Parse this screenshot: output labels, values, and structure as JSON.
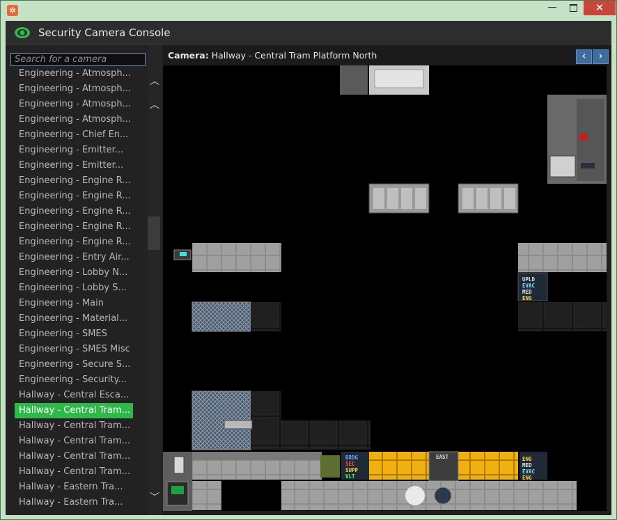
{
  "window": {
    "close_glyph": "✕",
    "minimize_glyph": "—"
  },
  "header": {
    "title": "Security Camera Console"
  },
  "search": {
    "placeholder": "Search for a camera"
  },
  "camera_list": [
    "Engineering - Atmosph...",
    "Engineering - Atmosph...",
    "Engineering - Atmosph...",
    "Engineering - Atmosph...",
    "Engineering - Chief En...",
    "Engineering - Emitter...",
    "Engineering - Emitter...",
    "Engineering - Engine R...",
    "Engineering - Engine R...",
    "Engineering - Engine R...",
    "Engineering - Engine R...",
    "Engineering - Engine R...",
    "Engineering - Entry Air...",
    "Engineering - Lobby N...",
    "Engineering - Lobby S...",
    "Engineering - Main",
    "Engineering - Material...",
    "Engineering - SMES",
    "Engineering - SMES Misc",
    "Engineering - Secure S...",
    "Engineering - Security...",
    "Hallway - Central Esca...",
    "Hallway - Central Tram...",
    "Hallway - Central Tram...",
    "Hallway - Central Tram...",
    "Hallway - Central Tram...",
    "Hallway - Central Tram...",
    "Hallway - Eastern Tra...",
    "Hallway - Eastern Tra..."
  ],
  "selected_index": 22,
  "camera": {
    "label": "Camera:",
    "name": "Hallway - Central Tram Platform North",
    "prev_glyph": "‹",
    "next_glyph": "›"
  },
  "map": {
    "signs_left": [
      "BRDG",
      "SEC",
      "SUPP",
      "VLT"
    ],
    "sign_east": "EAST",
    "signs_right_top": [
      "UPLD",
      "EVAC",
      "MED",
      "ENG"
    ],
    "signs_right_bottom": [
      "ENG",
      "MED",
      "EVAC",
      "ENG"
    ]
  },
  "colors": {
    "accent": "#2fb94a",
    "nav_button": "#3e6d9e",
    "close_button": "#c7463b"
  }
}
